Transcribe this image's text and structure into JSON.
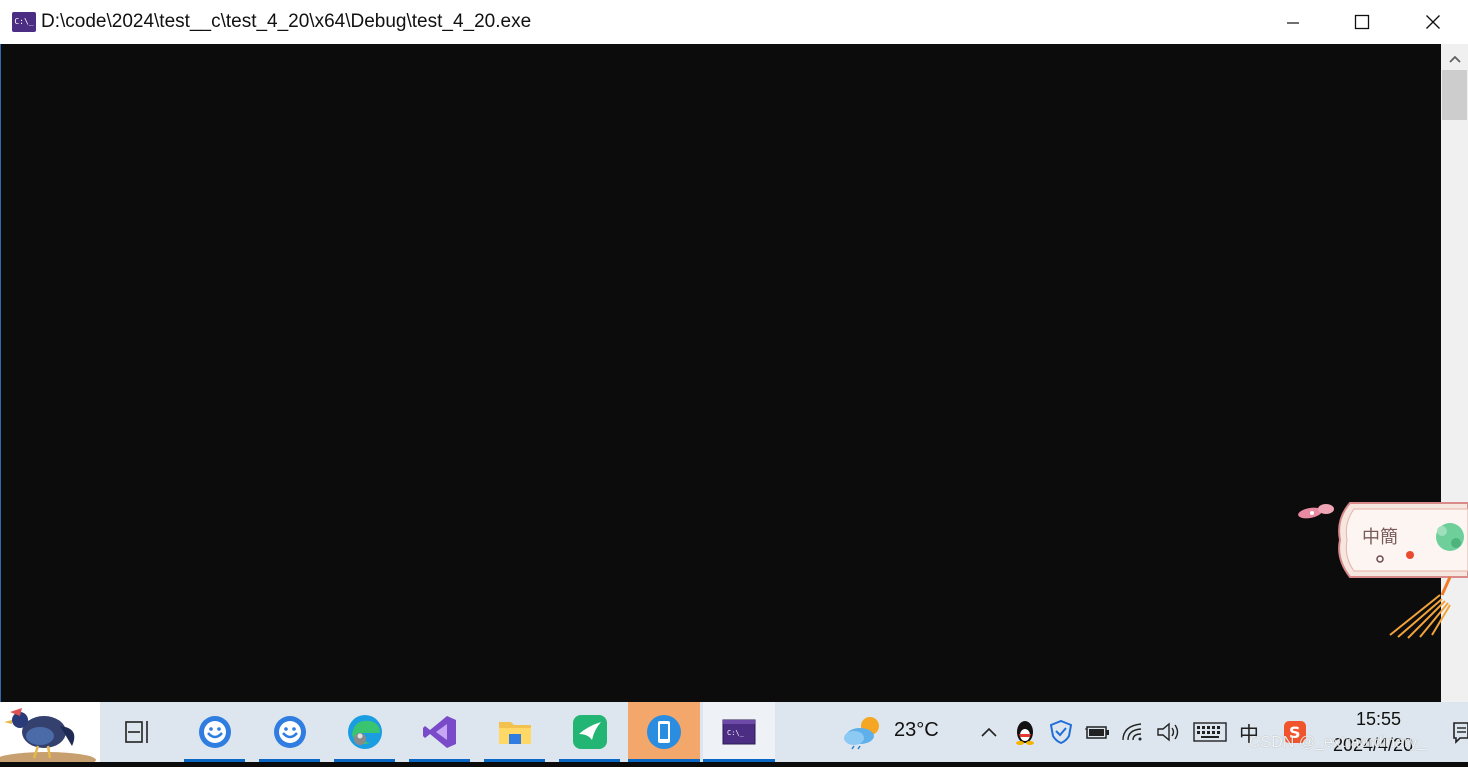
{
  "window": {
    "icon_label": "C:\\_",
    "title": "D:\\code\\2024\\test__c\\test_4_20\\x64\\Debug\\test_4_20.exe",
    "controls": {
      "minimize_icon": "minimize-icon",
      "maximize_icon": "maximize-icon",
      "close_icon": "close-icon"
    }
  },
  "console": {
    "background": "#0c0c0c",
    "text": ""
  },
  "decoration": {
    "label": "中簡"
  },
  "taskbar": {
    "background": "#dde6ee",
    "accent": "#0a67c4",
    "apps": [
      {
        "name": "task-view",
        "icon": "task-view-icon",
        "running": false
      },
      {
        "name": "app-blue-face-1",
        "icon": "face-app-icon",
        "running": true
      },
      {
        "name": "app-blue-face-2",
        "icon": "face-app-icon",
        "running": true
      },
      {
        "name": "edge",
        "icon": "edge-icon",
        "running": true
      },
      {
        "name": "visual-studio",
        "icon": "visual-studio-icon",
        "running": true
      },
      {
        "name": "file-explorer",
        "icon": "folder-icon",
        "running": true
      },
      {
        "name": "pdf-app",
        "icon": "pdf-swift-icon",
        "running": true
      },
      {
        "name": "phone-app",
        "icon": "phone-icon",
        "running": true,
        "highlight": "#f3a76b"
      },
      {
        "name": "console",
        "icon": "console-icon",
        "running": true,
        "active": true
      }
    ],
    "weather": {
      "icon": "cloud-sun-icon",
      "temperature": "23°C"
    },
    "tray": {
      "icons": [
        "chevron-up-icon",
        "qq-penguin-icon",
        "shield-icon",
        "battery-icon",
        "wifi-icon",
        "volume-icon",
        "keyboard-icon",
        "sogou-icon"
      ],
      "ime": "中"
    },
    "clock": {
      "time": "15:55",
      "date": "2024/4/20"
    },
    "watermark": "CSDN @_extraordinary_"
  }
}
